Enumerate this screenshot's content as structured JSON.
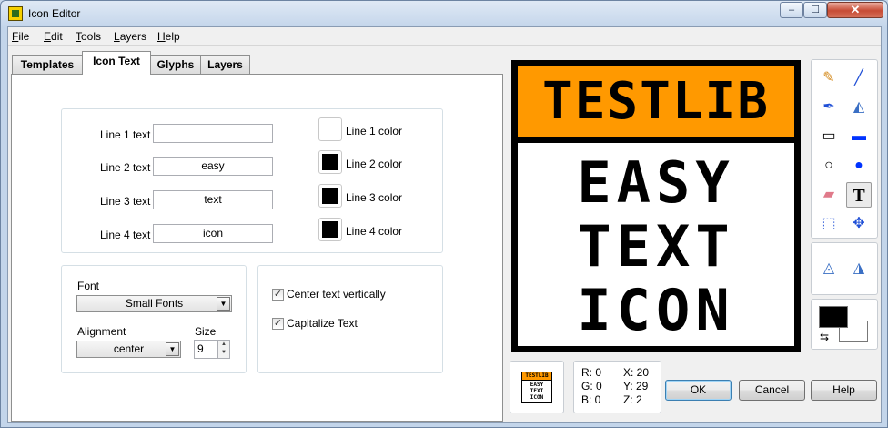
{
  "window": {
    "title": "Icon Editor",
    "minimize_glyph": "‒",
    "maximize_glyph": "☐",
    "close_glyph": "✕"
  },
  "menu": [
    {
      "pre": "",
      "key": "F",
      "post": "ile"
    },
    {
      "pre": "",
      "key": "E",
      "post": "dit"
    },
    {
      "pre": "",
      "key": "T",
      "post": "ools"
    },
    {
      "pre": "",
      "key": "L",
      "post": "ayers"
    },
    {
      "pre": "",
      "key": "H",
      "post": "elp"
    }
  ],
  "tabs": [
    "Templates",
    "Icon Text",
    "Glyphs",
    "Layers"
  ],
  "active_tab": "Icon Text",
  "text_lines": [
    {
      "label": "Line 1 text",
      "value": "",
      "color_label": "Line 1 color",
      "color": "#ffffff"
    },
    {
      "label": "Line 2 text",
      "value": "easy",
      "color_label": "Line 2 color",
      "color": "#000000"
    },
    {
      "label": "Line 3 text",
      "value": "text",
      "color_label": "Line 3 color",
      "color": "#000000"
    },
    {
      "label": "Line 4 text",
      "value": "icon",
      "color_label": "Line 4 color",
      "color": "#000000"
    }
  ],
  "font": {
    "label": "Font",
    "value": "Small Fonts"
  },
  "alignment": {
    "label": "Alignment",
    "value": "center"
  },
  "size": {
    "label": "Size",
    "value": "9"
  },
  "options": {
    "center_vertically": {
      "label": "Center text vertically",
      "checked": true
    },
    "capitalize": {
      "label": "Capitalize Text",
      "checked": true
    }
  },
  "preview": {
    "banner_text": "TESTLIB",
    "lines": [
      "EASY",
      "TEXT",
      "ICON"
    ],
    "banner_color": "#ff9900"
  },
  "tools": [
    {
      "name": "pencil-icon",
      "glyph": "✎",
      "color": "#d48a1c"
    },
    {
      "name": "line-icon",
      "glyph": "╱",
      "color": "#1f4fd6"
    },
    {
      "name": "color-picker-icon",
      "glyph": "✒",
      "color": "#1f4fd6"
    },
    {
      "name": "fill-bucket-icon",
      "glyph": "◭",
      "color": "#3a6fc4"
    },
    {
      "name": "rectangle-icon",
      "glyph": "▭",
      "color": "#000000"
    },
    {
      "name": "filled-rectangle-icon",
      "glyph": "▬",
      "color": "#0033ff"
    },
    {
      "name": "ellipse-icon",
      "glyph": "○",
      "color": "#000000"
    },
    {
      "name": "filled-ellipse-icon",
      "glyph": "●",
      "color": "#0033ff"
    },
    {
      "name": "eraser-icon",
      "glyph": "▰",
      "color": "#e07a8a"
    },
    {
      "name": "text-tool-icon",
      "glyph": "T",
      "color": "#000000"
    },
    {
      "name": "select-icon",
      "glyph": "⬚",
      "color": "#1f4fd6"
    },
    {
      "name": "move-icon",
      "glyph": "✥",
      "color": "#1f4fd6"
    }
  ],
  "selected_tool": "text-tool-icon",
  "flips": [
    {
      "name": "flip-horizontal-icon",
      "glyph": "◬",
      "color": "#3a6fc4"
    },
    {
      "name": "rotate-icon",
      "glyph": "◮",
      "color": "#3a6fc4"
    }
  ],
  "colors": {
    "foreground": "#000000",
    "background": "#ffffff",
    "swap_glyph": "⇆"
  },
  "thumbnail": {
    "lines": [
      "TESTLIB",
      "EASY",
      "TEXT",
      "ICON"
    ]
  },
  "coords": {
    "r": "R: 0",
    "g": "G: 0",
    "b": "B: 0",
    "x": "X: 20",
    "y": "Y: 29",
    "z": "Z: 2"
  },
  "buttons": {
    "ok": "OK",
    "cancel": "Cancel",
    "help": "Help"
  }
}
